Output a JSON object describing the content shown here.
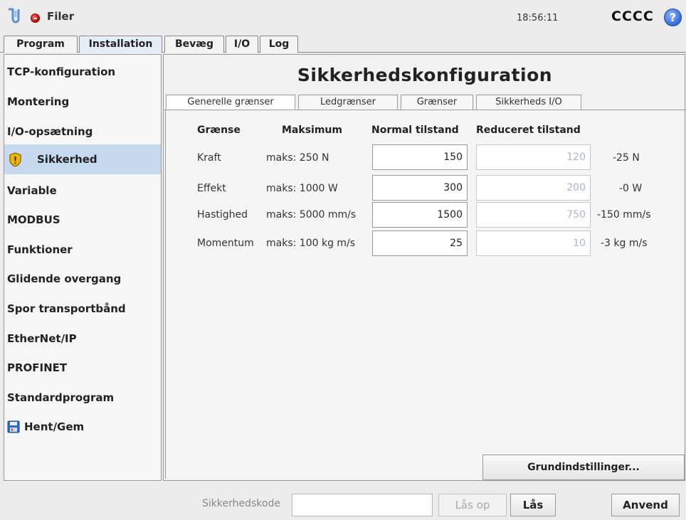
{
  "header": {
    "file_menu": "Filer",
    "clock": "18:56:11",
    "robot_name": "CCCC",
    "help": "?"
  },
  "main_tabs": [
    "Program",
    "Installation",
    "Bevæg",
    "I/O",
    "Log"
  ],
  "main_tab_active": "Installation",
  "sidebar": {
    "items": [
      "TCP-konfiguration",
      "Montering",
      "I/O-opsætning",
      "Sikkerhed",
      "Variable",
      "MODBUS",
      "Funktioner",
      "Glidende overgang",
      "Spor transportbånd",
      "EtherNet/IP",
      "PROFINET",
      "Standardprogram",
      "Hent/Gem"
    ],
    "active": "Sikkerhed"
  },
  "content": {
    "title": "Sikkerhedskonfiguration",
    "subtabs": [
      "Generelle grænser",
      "Ledgrænser",
      "Grænser",
      "Sikkerheds I/O"
    ],
    "subtab_active": "Generelle grænser",
    "columns": [
      "Grænse",
      "Maksimum",
      "Normal tilstand",
      "Reduceret tilstand"
    ],
    "rows": [
      {
        "label": "Kraft",
        "max": "maks: 250 N",
        "normal": "150",
        "reduced": "120",
        "diff": "-25 N"
      },
      {
        "label": "Effekt",
        "max": "maks: 1000 W",
        "normal": "300",
        "reduced": "200",
        "diff": "-0 W"
      },
      {
        "label": "Hastighed",
        "max": "maks: 5000 mm/s",
        "normal": "1500",
        "reduced": "750",
        "diff": "-150 mm/s"
      },
      {
        "label": "Momentum",
        "max": "maks: 100 kg m/s",
        "normal": "25",
        "reduced": "10",
        "diff": "-3 kg m/s"
      }
    ],
    "defaults_button": "Grundindstillinger..."
  },
  "footer": {
    "password_label": "Sikkerhedskode",
    "password_value": "",
    "unlock_button": "Lås op",
    "lock_button": "Lås",
    "apply_button": "Anvend"
  },
  "colors": {
    "active_sidebar": "#c7d9ee",
    "reduced_text": "#a8b8c8",
    "stop_red": "#c40000",
    "help_blue": "#2f66d6"
  }
}
